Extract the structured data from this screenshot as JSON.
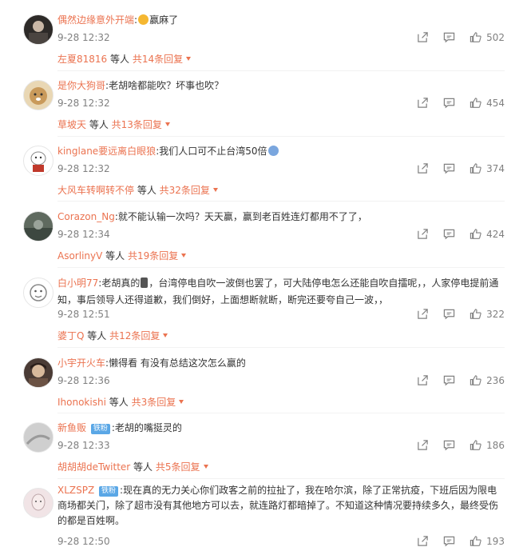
{
  "comments": [
    {
      "user": "偶然边缘意外开端",
      "colon": ":",
      "text": "赢麻了",
      "badge": "",
      "emoji_before": "smile-emoji",
      "time": "9-28 12:32",
      "likes": "502",
      "reply_user": "左夏81816",
      "reply_mid": " 等人 ",
      "reply_more": "共14条回复"
    },
    {
      "user": "是你大狗哥",
      "colon": ":",
      "text": "老胡啥都能吹？坏事也吹？",
      "badge": "",
      "emoji_before": "",
      "time": "9-28 12:32",
      "likes": "454",
      "reply_user": "草坡天",
      "reply_mid": " 等人 ",
      "reply_more": "共13条回复"
    },
    {
      "user": "kinglane要远离白眼狼",
      "colon": ":",
      "text": "我们人口可不止台湾50倍",
      "badge": "",
      "emoji_after": "sweat-emoji",
      "time": "9-28 12:32",
      "likes": "374",
      "reply_user": "大风车转啊转不停",
      "reply_mid": " 等人 ",
      "reply_more": "共32条回复"
    },
    {
      "user": "Corazon_Ng",
      "colon": ":",
      "text": "就不能认输一次吗？天天赢，赢到老百姓连灯都用不了了，",
      "badge": "",
      "time": "9-28 12:34",
      "likes": "424",
      "reply_user": "AsorlinyV",
      "reply_mid": " 等人 ",
      "reply_more": "共19条回复"
    },
    {
      "user": "白小明77",
      "colon": ":",
      "text_a": "老胡真的",
      "text_b": "，台湾停电自吹一波倒也罢了，可大陆停电怎么还能自吹自擂呢，，人家停电提前通知，事后领导人还得道歉，我们倒好，上面想断就断，断完还要夸自己一波，，",
      "badge": "",
      "time": "9-28 12:51",
      "likes": "322",
      "reply_user": "婆丁Q",
      "reply_mid": " 等人 ",
      "reply_more": "共12条回复"
    },
    {
      "user": "小宇开火车",
      "colon": ":",
      "text": "懒得看 有没有总结这次怎么赢的",
      "badge": "",
      "time": "9-28 12:36",
      "likes": "236",
      "reply_user": "Ihonokishi",
      "reply_mid": " 等人 ",
      "reply_more": "共3条回复"
    },
    {
      "user": "新鱼贩",
      "colon": ":",
      "text": "老胡的嘴挺灵的",
      "badge": "铁粉",
      "time": "9-28 12:33",
      "likes": "186",
      "reply_user": "胡胡胡deTwitter",
      "reply_mid": " 等人 ",
      "reply_more": "共5条回复"
    },
    {
      "user": "XLZSPZ",
      "colon": ":",
      "text": "现在真的无力关心你们政客之前的拉扯了，我在哈尔滨，除了正常抗疫，下班后因为限电商场都关门，除了超市没有其他地方可以去，就连路灯都暗掉了。不知道这种情况要持续多久，最终受伤的都是百姓啊。",
      "badge": "铁粉",
      "time": "9-28 12:50",
      "likes": "193"
    }
  ],
  "colors": {
    "username": "#eb7350",
    "meta": "#808080",
    "badge": "#5aa7e6"
  },
  "icons": {
    "share": "share-icon",
    "comment": "comment-icon",
    "like": "like-icon"
  }
}
